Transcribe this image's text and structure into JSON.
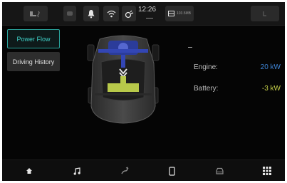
{
  "status_bar": {
    "time": "12:26",
    "media_label": "103.5MB",
    "icons": [
      "seat-heat-icon",
      "connected-car-icon",
      "notification-bell-icon",
      "wifi-icon",
      "voice-assistant-icon",
      "media-source-icon",
      "climate-icon"
    ]
  },
  "menu": {
    "power_flow": "Power Flow",
    "driving_history": "Driving History"
  },
  "power": {
    "engine_label": "Engine:",
    "engine_value": "20 kW",
    "battery_label": "Battery:",
    "battery_value": "-3 kW"
  },
  "colors": {
    "accent": "#3fcfc6",
    "engine": "#3f86d8",
    "battery": "#c9d34a"
  },
  "nav": {
    "icons": [
      "home-icon",
      "music-icon",
      "navigation-icon",
      "phone-icon",
      "car-icon",
      "apps-icon"
    ]
  }
}
